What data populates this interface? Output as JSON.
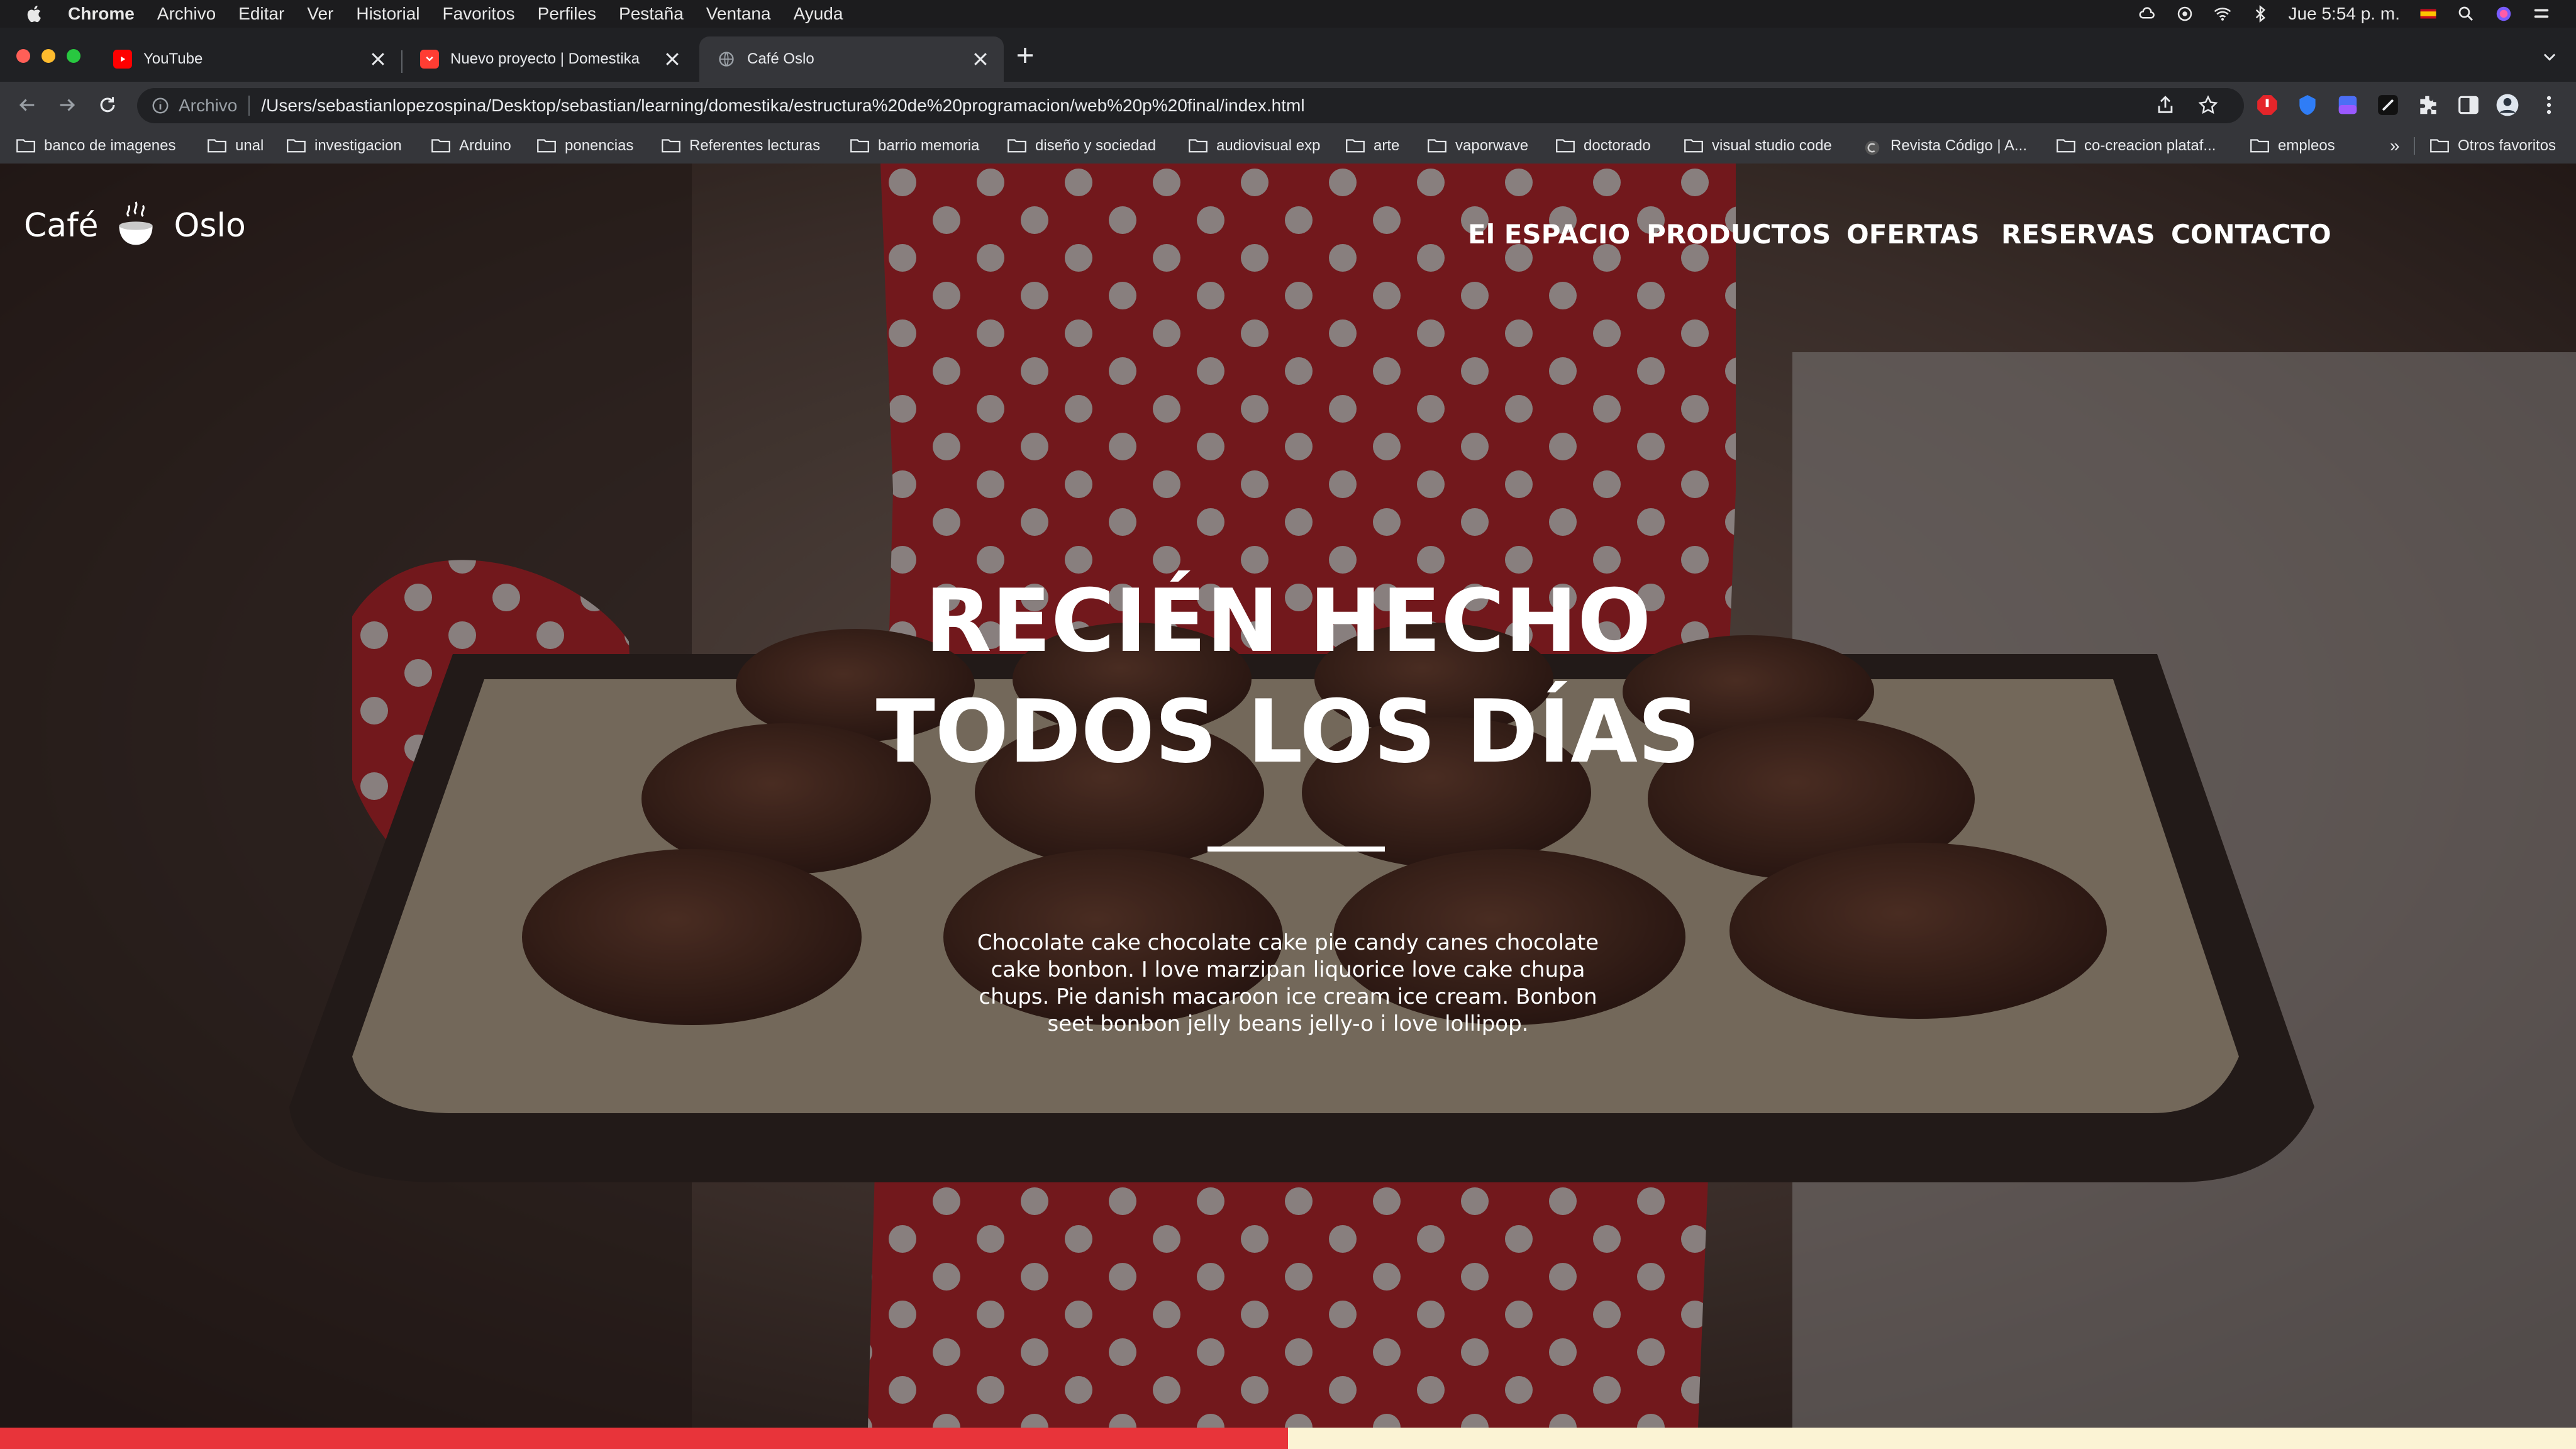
{
  "menubar": {
    "app": "Chrome",
    "items": [
      "Archivo",
      "Editar",
      "Ver",
      "Historial",
      "Favoritos",
      "Perfiles",
      "Pestaña",
      "Ventana",
      "Ayuda"
    ],
    "clock": "Jue 5:54 p. m."
  },
  "tabs": [
    {
      "title": "YouTube",
      "icon": "youtube-icon"
    },
    {
      "title": "Nuevo proyecto | Domestika",
      "icon": "domestika-icon"
    },
    {
      "title": "Café Oslo",
      "icon": "globe-icon"
    }
  ],
  "toolbar": {
    "scheme": "Archivo",
    "url": "/Users/sebastianlopezospina/Desktop/sebastian/learning/domestika/estructura%20de%20programacion/web%20p%20final/index.html"
  },
  "bookmarks": {
    "items": [
      "banco de imagenes",
      "unal",
      "investigacion",
      "Arduino",
      "ponencias",
      "Referentes lecturas",
      "barrio memoria",
      "diseño y sociedad",
      "audiovisual exp",
      "arte",
      "vaporwave",
      "doctorado",
      "visual studio code",
      "Revista Código | A...",
      "co-creacion plataf...",
      "empleos"
    ],
    "overflow": "»",
    "others": "Otros favoritos"
  },
  "site": {
    "logo_left": "Café",
    "logo_right": "Oslo",
    "nav": [
      "El ESPACIO",
      "PRODUCTOS",
      "OFERTAS",
      "RESERVAS",
      "CONTACTO"
    ],
    "headline_line1": "RECIÉN HECHO",
    "headline_line2": "TODOS LOS DÍAS",
    "description": "Chocolate cake chocolate cake pie candy canes chocolate cake bonbon. I love marzipan liquorice love cake chupa chups. Pie danish macaroon ice cream ice cream. Bonbon seet bonbon jelly beans jelly-o i love lollipop."
  },
  "colors": {
    "accent_red": "#e8343a",
    "cream": "#fbf3d4",
    "chrome_dark": "#202124",
    "chrome_toolbar": "#35363a"
  }
}
